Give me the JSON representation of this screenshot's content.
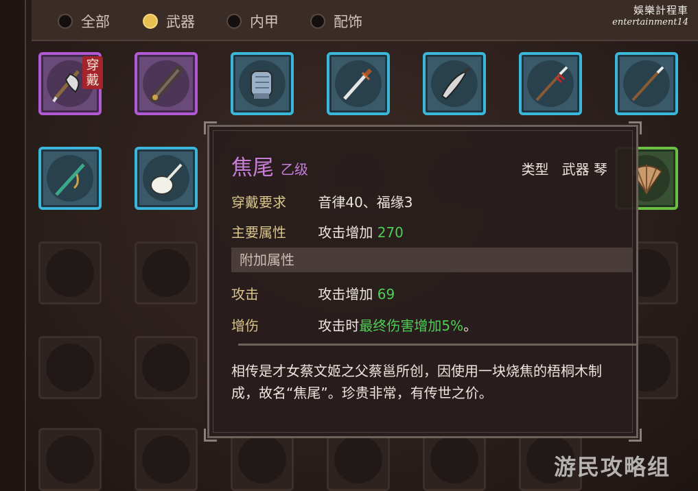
{
  "filters": [
    {
      "label": "全部",
      "selected": false
    },
    {
      "label": "武器",
      "selected": true
    },
    {
      "label": "内甲",
      "selected": false
    },
    {
      "label": "配饰",
      "selected": false
    }
  ],
  "watermark": {
    "line1": "娛樂計程車",
    "line2": "entertainment14",
    "bottom": "游民攻略组"
  },
  "grid": {
    "badge_label": "穿戴",
    "row1": [
      {
        "item": "halberd-icon",
        "rarity": "purple",
        "equipped": true
      },
      {
        "item": "bundle-icon",
        "rarity": "purple"
      },
      {
        "item": "gauntlet-icon",
        "rarity": "blue"
      },
      {
        "item": "sword-icon",
        "rarity": "blue"
      },
      {
        "item": "saber-icon",
        "rarity": "blue"
      },
      {
        "item": "spear-icon",
        "rarity": "blue"
      },
      {
        "item": "staff-icon",
        "rarity": "blue"
      }
    ],
    "row2": [
      {
        "item": "flute-icon",
        "rarity": "blue"
      },
      {
        "item": "pipa-icon",
        "rarity": "blue"
      },
      {
        "item": "fan-icon",
        "rarity": "green"
      }
    ]
  },
  "tooltip": {
    "name": "焦尾",
    "grade": "乙级",
    "type_label": "类型",
    "type_value": "武器 琴",
    "req_label": "穿戴要求",
    "req_value": "音律40、福缘3",
    "main_label": "主要属性",
    "main_prefix": "攻击增加 ",
    "main_value": "270",
    "extra_header": "附加属性",
    "attack_label": "攻击",
    "attack_prefix": "攻击增加 ",
    "attack_value": "69",
    "dmg_label": "增伤",
    "dmg_prefix": "攻击时",
    "dmg_value": "最终伤害增加5%",
    "dmg_suffix": "。",
    "description": "相传是才女蔡文姬之父蔡邕所创，因使用一块烧焦的梧桐木制成，故名“焦尾”。珍贵非常，有传世之价。"
  }
}
